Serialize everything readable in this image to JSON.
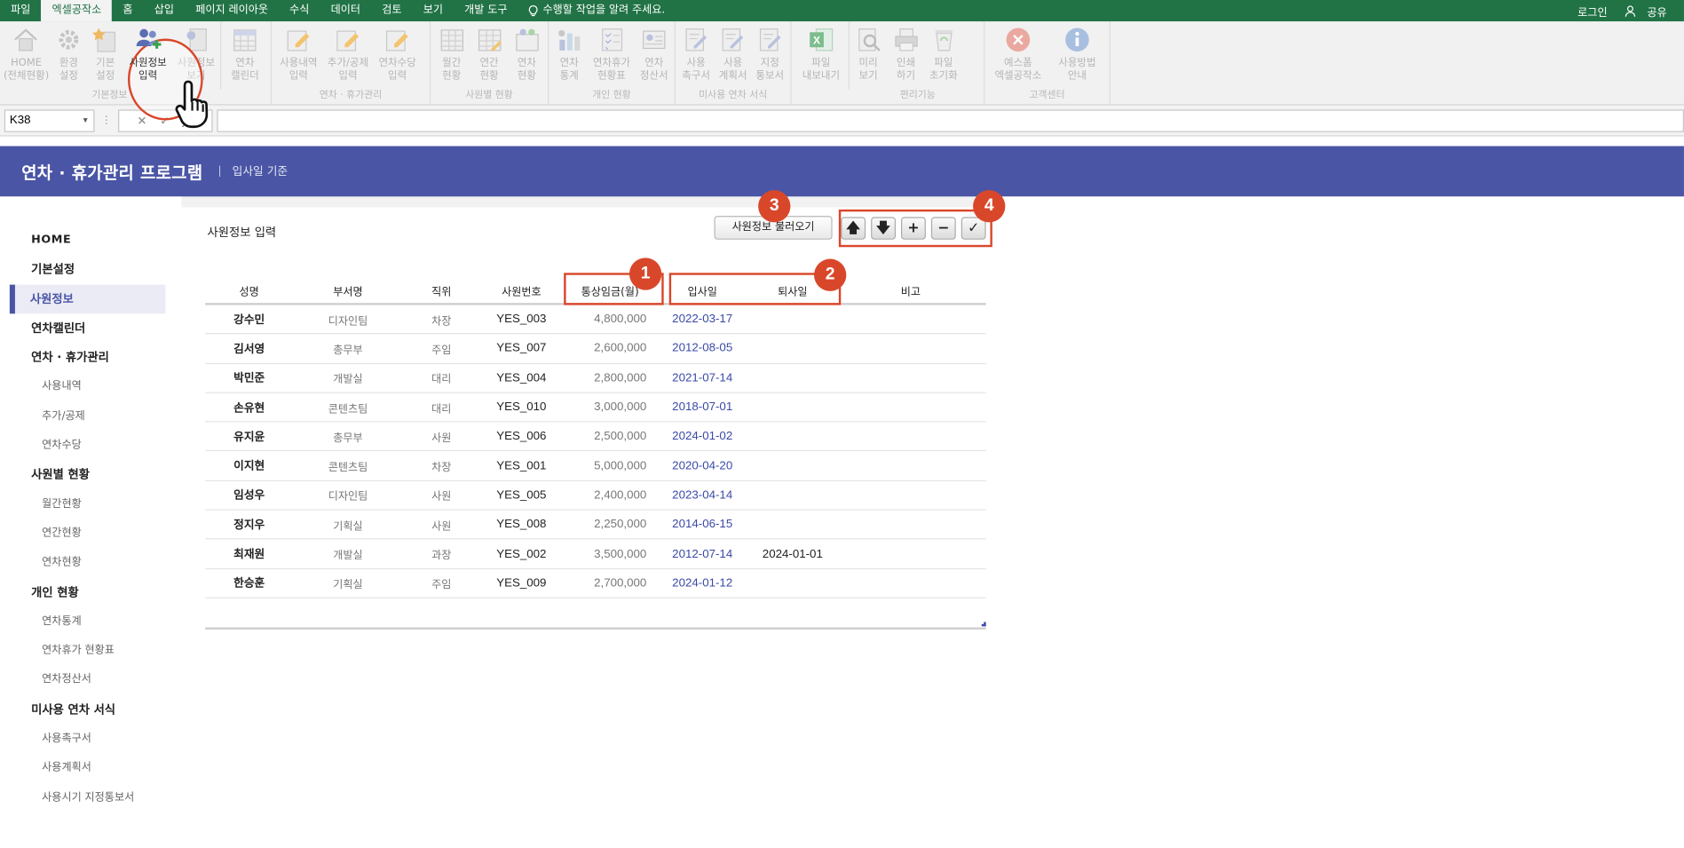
{
  "menu": {
    "items": [
      "파일",
      "엑셀공작소",
      "홈",
      "삽입",
      "페이지 레이아웃",
      "수식",
      "데이터",
      "검토",
      "보기",
      "개발 도구"
    ],
    "active_index": 1,
    "tell_me": "수행할 작업을 알려 주세요.",
    "login": "로그인",
    "share": "공유"
  },
  "ribbon": {
    "groups": [
      {
        "name": "기본정보",
        "buttons": [
          {
            "label1": "HOME",
            "label2": "(전체현황)",
            "icon": "home-icon"
          },
          {
            "label1": "환경",
            "label2": "설정",
            "icon": "gear-icon"
          },
          {
            "label1": "기본",
            "label2": "설정",
            "icon": "star-icon"
          },
          {
            "label1": "사원정보",
            "label2": "입력",
            "icon": "add-users-icon"
          },
          {
            "label1": "사원정보",
            "label2": "보기",
            "icon": "user-doc-icon"
          }
        ]
      },
      {
        "name": "",
        "buttons": [
          {
            "label1": "연차",
            "label2": "캘린더",
            "icon": "calendar-icon"
          }
        ]
      },
      {
        "name": "연차 · 휴가관리",
        "buttons": [
          {
            "label1": "사용내역",
            "label2": "입력",
            "icon": "edit-doc-icon"
          },
          {
            "label1": "추가/공제",
            "label2": "입력",
            "icon": "edit-doc-icon"
          },
          {
            "label1": "연차수당",
            "label2": "입력",
            "icon": "edit-doc-icon"
          }
        ]
      },
      {
        "name": "사원별 현황",
        "buttons": [
          {
            "label1": "월간",
            "label2": "현황",
            "icon": "grid-icon"
          },
          {
            "label1": "연간",
            "label2": "현황",
            "icon": "grid-icon"
          },
          {
            "label1": "연차",
            "label2": "현황",
            "icon": "people-grid-icon"
          }
        ]
      },
      {
        "name": "개인 현황",
        "buttons": [
          {
            "label1": "연차",
            "label2": "통계",
            "icon": "bar-chart-icon"
          },
          {
            "label1": "연차휴가",
            "label2": "현황표",
            "icon": "checklist-icon"
          },
          {
            "label1": "연차",
            "label2": "정산서",
            "icon": "id-card-icon"
          }
        ]
      },
      {
        "name": "미사용 연차 서식",
        "buttons": [
          {
            "label1": "사용",
            "label2": "촉구서",
            "icon": "pen-doc-icon"
          },
          {
            "label1": "사용",
            "label2": "계획서",
            "icon": "pen-doc-icon"
          },
          {
            "label1": "지정",
            "label2": "통보서",
            "icon": "pen-doc-icon"
          }
        ]
      },
      {
        "name": "",
        "buttons": [
          {
            "label1": "파일",
            "label2": "내보내기",
            "icon": "excel-icon"
          }
        ]
      },
      {
        "name": "편리기능",
        "buttons": [
          {
            "label1": "미리",
            "label2": "보기",
            "icon": "preview-icon"
          },
          {
            "label1": "인쇄",
            "label2": "하기",
            "icon": "printer-icon"
          },
          {
            "label1": "파일",
            "label2": "초기화",
            "icon": "recycle-icon"
          }
        ]
      },
      {
        "name": "고객센터",
        "buttons": [
          {
            "label1": "예스폼",
            "label2": "엑셀공작소",
            "icon": "brand-icon"
          },
          {
            "label1": "사용방법",
            "label2": "안내",
            "icon": "info-icon"
          }
        ]
      }
    ]
  },
  "formula_bar": {
    "name_box": "K38",
    "fx": "fx",
    "value": ""
  },
  "app": {
    "title": "연차 · 휴가관리 프로그램",
    "separator": "|",
    "subtitle": "입사일 기준"
  },
  "sidebar": {
    "items": [
      {
        "label": "HOME",
        "type": "home"
      },
      {
        "label": "기본설정",
        "type": "main"
      },
      {
        "label": "사원정보",
        "type": "main",
        "active": true
      },
      {
        "label": "연차캘린더",
        "type": "main"
      },
      {
        "label": "연차 · 휴가관리",
        "type": "main"
      },
      {
        "label": "사용내역",
        "type": "sub"
      },
      {
        "label": "추가/공제",
        "type": "sub"
      },
      {
        "label": "연차수당",
        "type": "sub"
      },
      {
        "label": "사원별 현황",
        "type": "main"
      },
      {
        "label": "월간현황",
        "type": "sub"
      },
      {
        "label": "연간현황",
        "type": "sub"
      },
      {
        "label": "연차현황",
        "type": "sub"
      },
      {
        "label": "개인 현황",
        "type": "main"
      },
      {
        "label": "연차통계",
        "type": "sub"
      },
      {
        "label": "연차휴가 현황표",
        "type": "sub"
      },
      {
        "label": "연차정산서",
        "type": "sub"
      },
      {
        "label": "미사용 연차 서식",
        "type": "main"
      },
      {
        "label": "사용촉구서",
        "type": "sub"
      },
      {
        "label": "사용계획서",
        "type": "sub"
      },
      {
        "label": "사용시기 지정통보서",
        "type": "sub"
      }
    ]
  },
  "main": {
    "title": "사원정보 입력",
    "load_button": "사원정보 불러오기",
    "tools": [
      "▲",
      "▼",
      "+",
      "−",
      "✓"
    ],
    "headers": [
      "성명",
      "부서명",
      "직위",
      "사원번호",
      "통상임금(월)",
      "입사일",
      "퇴사일",
      "비고"
    ],
    "rows": [
      [
        "강수민",
        "디자인팀",
        "차장",
        "YES_003",
        "4,800,000",
        "2022-03-17",
        "",
        ""
      ],
      [
        "김서영",
        "총무부",
        "주임",
        "YES_007",
        "2,600,000",
        "2012-08-05",
        "",
        ""
      ],
      [
        "박민준",
        "개발실",
        "대리",
        "YES_004",
        "2,800,000",
        "2021-07-14",
        "",
        ""
      ],
      [
        "손유현",
        "콘텐츠팀",
        "대리",
        "YES_010",
        "3,000,000",
        "2018-07-01",
        "",
        ""
      ],
      [
        "유지윤",
        "총무부",
        "사원",
        "YES_006",
        "2,500,000",
        "2024-01-02",
        "",
        ""
      ],
      [
        "이지현",
        "콘텐츠팀",
        "차장",
        "YES_001",
        "5,000,000",
        "2020-04-20",
        "",
        ""
      ],
      [
        "임성우",
        "디자인팀",
        "사원",
        "YES_005",
        "2,400,000",
        "2023-04-14",
        "",
        ""
      ],
      [
        "정지우",
        "기획실",
        "사원",
        "YES_008",
        "2,250,000",
        "2014-06-15",
        "",
        ""
      ],
      [
        "최재원",
        "개발실",
        "과장",
        "YES_002",
        "3,500,000",
        "2012-07-14",
        "2024-01-01",
        ""
      ],
      [
        "한승훈",
        "기획실",
        "주임",
        "YES_009",
        "2,700,000",
        "2024-01-12",
        "",
        ""
      ]
    ]
  },
  "annotations": [
    "1",
    "2",
    "3",
    "4"
  ],
  "colors": {
    "excel_green": "#217346",
    "app_header": "#4a55a5",
    "annotation": "#d9472b",
    "date_blue": "#3b49a8"
  }
}
